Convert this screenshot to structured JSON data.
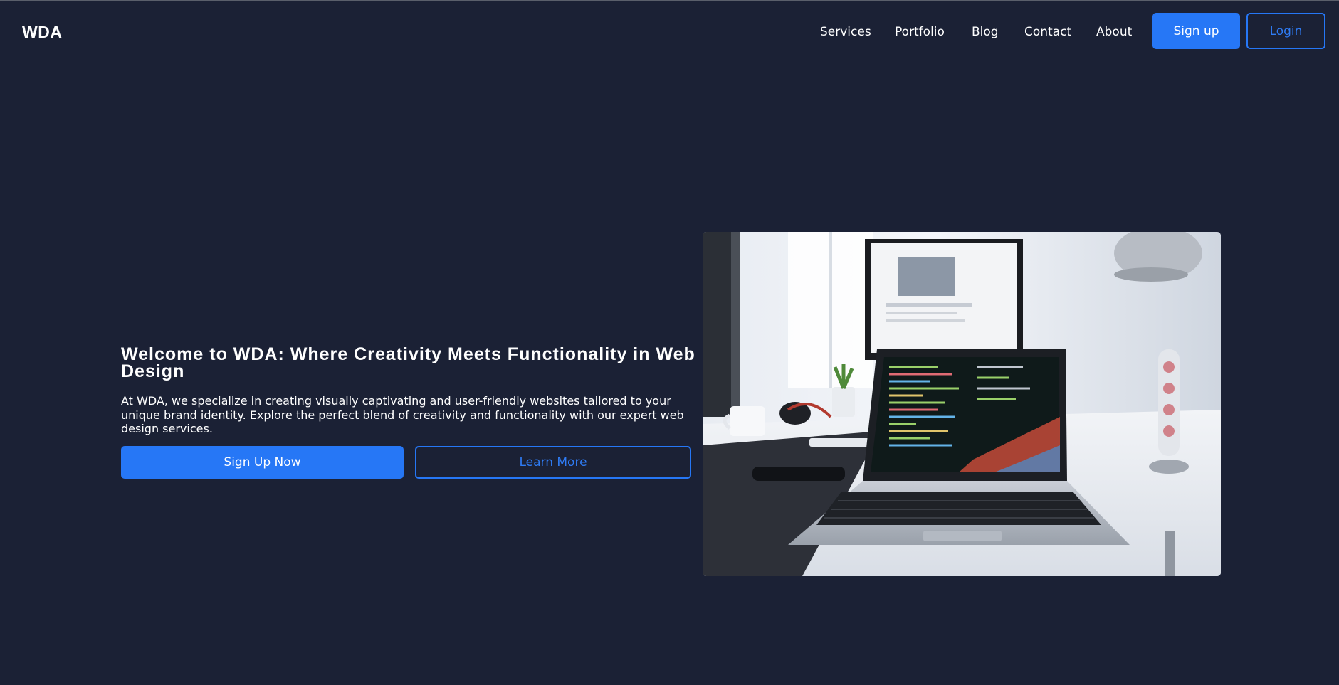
{
  "brand": {
    "logo": "WDA"
  },
  "nav": {
    "items": [
      {
        "label": "Services"
      },
      {
        "label": "Portfolio"
      },
      {
        "label": "Blog"
      },
      {
        "label": "Contact"
      },
      {
        "label": "About"
      }
    ],
    "signup_label": "Sign up",
    "login_label": "Login"
  },
  "hero": {
    "title": "Welcome to WDA: Where Creativity Meets Functionality in Web Design",
    "description": "At WDA, we specialize in creating visually captivating and user-friendly websites tailored to your unique brand identity. Explore the perfect blend of creativity and functionality with our expert web design services.",
    "primary_cta": "Sign Up Now",
    "secondary_cta": "Learn More",
    "image_alt": "laptop-on-desk-photo"
  },
  "colors": {
    "background": "#1b2135",
    "accent": "#2677f6",
    "text": "#ffffff"
  }
}
